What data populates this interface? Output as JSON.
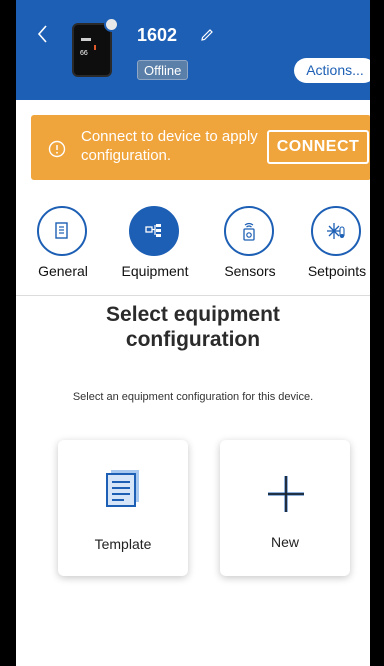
{
  "header": {
    "device_name": "1602",
    "status": "Offline",
    "actions_label": "Actions...",
    "thermostat_screen_value": "66",
    "colors": {
      "header_bg": "#1d5fb4"
    }
  },
  "banner": {
    "message": "Connect to device to apply configuration.",
    "connect_label": "CONNECT",
    "color": "#f0a43c"
  },
  "tabs": [
    {
      "label": "General",
      "icon": "document-icon",
      "active": false
    },
    {
      "label": "Equipment",
      "icon": "equipment-icon",
      "active": true
    },
    {
      "label": "Sensors",
      "icon": "sensor-icon",
      "active": false
    },
    {
      "label": "Setpoints",
      "icon": "snowflake-thermometer-icon",
      "active": false
    }
  ],
  "main": {
    "title_line1": "Select equipment",
    "title_line2": "configuration",
    "subtitle": "Select an equipment configuration for this device.",
    "options": [
      {
        "label": "Template",
        "icon": "template-icon"
      },
      {
        "label": "New",
        "icon": "plus-icon"
      }
    ]
  }
}
